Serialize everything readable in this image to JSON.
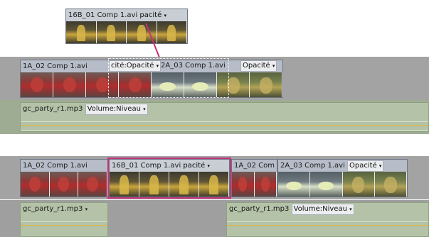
{
  "floating_clip": {
    "name": "16B_01 Comp 1.avi",
    "effect": "pacité"
  },
  "top_timeline": {
    "video_clips": [
      {
        "name": "1A_02 Comp 1.avi",
        "effect": "cité:Opacité"
      },
      {
        "name": "2A_03 Comp 1.avi",
        "effect": "Opacité"
      }
    ],
    "audio_clip": {
      "name": "gc_party_r1.mp3",
      "effect": "Volume:Niveau"
    }
  },
  "bottom_timeline": {
    "video_clips": [
      {
        "name": "1A_02 Comp 1.avi"
      },
      {
        "name": "16B_01 Comp 1.avi",
        "effect": "pacité"
      },
      {
        "name": "1A_02 Com"
      },
      {
        "name": "2A_03 Comp 1.avi",
        "effect": "Opacité"
      }
    ],
    "audio_left": {
      "name": "gc_party_r1.mp3"
    },
    "audio_right": {
      "name": "gc_party_r1.mp3",
      "effect": "Volume:Niveau"
    }
  },
  "dropdown_glyph": "▾",
  "colors": {
    "selection": "#c2327b",
    "drag_arrow": "#c2327b",
    "level_line": "#e0b33c"
  }
}
